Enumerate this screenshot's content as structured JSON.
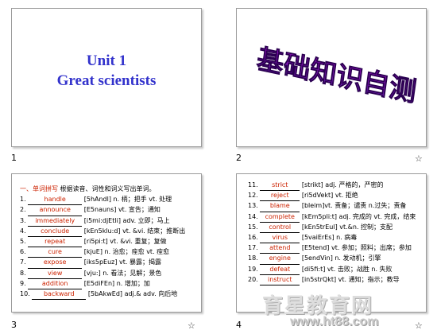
{
  "slides": {
    "s1": {
      "number": "1",
      "line1": "Unit 1",
      "line2": "Great scientists"
    },
    "s2": {
      "number": "2",
      "star": "☆",
      "title": "基础知识自测"
    },
    "s3": {
      "number": "3",
      "star": "☆",
      "heading_red": "一、单词拼写",
      "heading_rest": " 根据读音、词性和词义写出单词。",
      "items": [
        {
          "n": "1.",
          "word": "handle",
          "rest": "[5hAndl] n. 柄；把手 vt. 处理"
        },
        {
          "n": "2.",
          "word": "announce",
          "rest": "[E5nauns] vt. 宣告；通知"
        },
        {
          "n": "3.",
          "word": "immediately",
          "rest": "[i5mi:djEtli] adv. 立即；马上"
        },
        {
          "n": "4.",
          "word": "conclude",
          "rest": "[kEn5klu:d] vt. &vi. 结束；推断出"
        },
        {
          "n": "5.",
          "word": "repeat",
          "rest": "[ri5pi:t] vt. &vi. 重复；复做"
        },
        {
          "n": "6.",
          "word": "cure",
          "rest": "[kjuE] n. 治愈；痊愈 vt. 痊愈"
        },
        {
          "n": "7.",
          "word": "expose",
          "rest": "[iks5pEuz] vt. 暴露；揭露"
        },
        {
          "n": "8.",
          "word": "view",
          "rest": "[vju:] n. 看法；见解；景色"
        },
        {
          "n": "9.",
          "word": "addition",
          "rest": "[E5diFEn] n. 增加；加"
        },
        {
          "n": "10.",
          "word": "backward",
          "rest": "[5bAkwEd] adj.& adv. 向后地"
        }
      ]
    },
    "s4": {
      "number": "4",
      "star": "☆",
      "items": [
        {
          "n": "11.",
          "word": "strict",
          "rest": "[strikt] adj. 严格的，严密的"
        },
        {
          "n": "12.",
          "word": "reject",
          "rest": "[ri5dVekt] vt. 拒绝"
        },
        {
          "n": "13.",
          "word": "blame",
          "rest": "[bleim]vt. 责备；谴责 n.过失；责备"
        },
        {
          "n": "14.",
          "word": "complete",
          "rest": "[kEm5pli:t] adj. 完成的 vt. 完成，结束"
        },
        {
          "n": "15.",
          "word": "control",
          "rest": "[kEn5trEul] vt.&n. 控制；支配"
        },
        {
          "n": "16.",
          "word": "virus",
          "rest": "[5vaiErEs] n. 病毒"
        },
        {
          "n": "17.",
          "word": "attend",
          "rest": "[E5tend] vt. 参加；照料；出席；参加"
        },
        {
          "n": "18.",
          "word": "engine",
          "rest": "[5endVin] n. 发动机；引擎"
        },
        {
          "n": "19.",
          "word": "defeat",
          "rest": "[di5fi:t] vt. 击败；战胜 n. 失败"
        },
        {
          "n": "20.",
          "word": "instruct",
          "rest": "[in5strQkt] vt. 通知；指示；教导"
        }
      ]
    }
  },
  "watermark": {
    "cn": "育星教育网",
    "url": "www.ht88.com"
  }
}
